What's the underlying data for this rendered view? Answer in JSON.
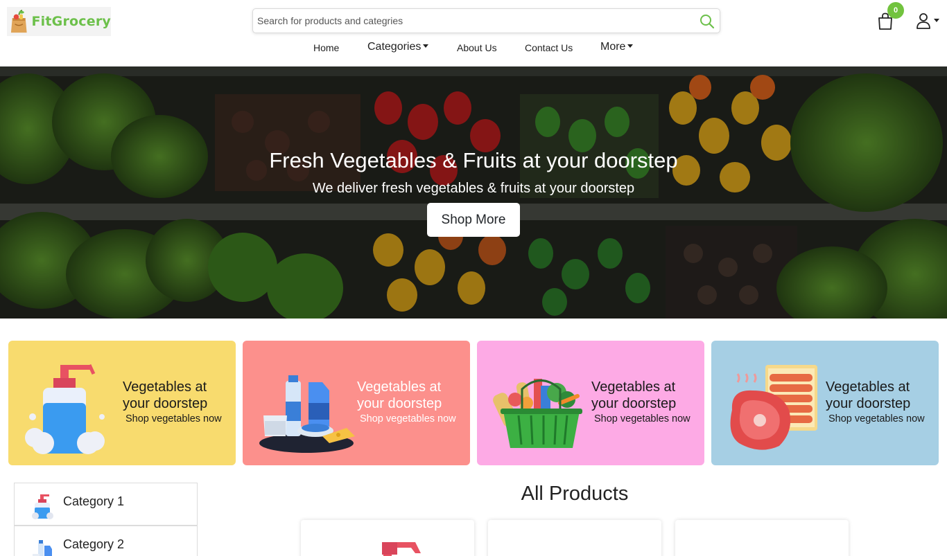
{
  "brand": {
    "name": "FitGrocery",
    "accent": "#6cc04a"
  },
  "search": {
    "placeholder": "Search for products and categries",
    "icon": "search-icon"
  },
  "nav": {
    "home": "Home",
    "categories": "Categories",
    "about": "About Us",
    "contact": "Contact Us",
    "more": "More"
  },
  "cart": {
    "count": "0",
    "icon": "shopping-bag-icon"
  },
  "user": {
    "icon": "user-icon"
  },
  "hero": {
    "title": "Fresh Vegetables & Fruits at your doorstep",
    "subtitle": "We deliver fresh vegetables & fruits at your doorstep",
    "button": "Shop More"
  },
  "promos": [
    {
      "title": "Vegetables at your doorstep",
      "subtitle": "Shop vegetables now",
      "bg": "#f8db6e",
      "text_color": "#1a1a1a",
      "icon": "soap-bottle-icon"
    },
    {
      "title": "Vegetables at your doorstep",
      "subtitle": "Shop vegetables now",
      "bg": "#fc908c",
      "text_color": "#ffffff",
      "icon": "dairy-icon"
    },
    {
      "title": "Vegetables at your doorstep",
      "subtitle": "Shop vegetables now",
      "bg": "#fdaae5",
      "text_color": "#1a1a1a",
      "icon": "grocery-basket-icon"
    },
    {
      "title": "Vegetables at your doorstep",
      "subtitle": "Shop vegetables now",
      "bg": "#a6cfe4",
      "text_color": "#1a1a1a",
      "icon": "meat-icon"
    }
  ],
  "sidebar": {
    "categories": [
      {
        "label": "Category 1",
        "icon": "soap-bottle-icon"
      },
      {
        "label": "Category 2",
        "icon": "dairy-icon"
      }
    ]
  },
  "products": {
    "title": "All Products"
  }
}
